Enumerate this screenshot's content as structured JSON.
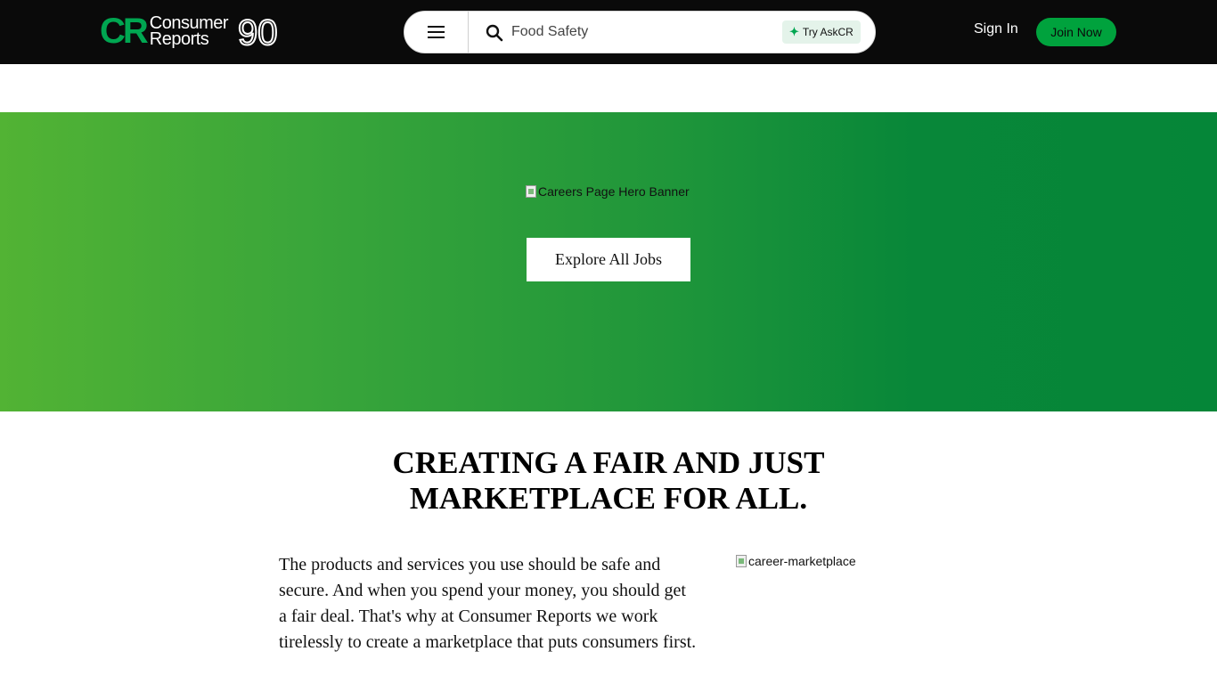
{
  "header": {
    "logo": {
      "cr": "CR",
      "line1": "Consumer",
      "line2": "Reports",
      "anniversary": "90"
    },
    "menu_icon": "hamburger-menu-icon",
    "search": {
      "icon": "search-icon",
      "value": "Food Safety",
      "placeholder": "Food Safety"
    },
    "askcr": {
      "icon": "sparkle-icon",
      "label": "Try AskCR"
    },
    "sign_in": "Sign In",
    "join_now": "Join Now"
  },
  "hero": {
    "image_alt": "Careers Page Hero Banner",
    "button_label": "Explore All Jobs"
  },
  "main": {
    "headline_line1": "CREATING A FAIR AND JUST",
    "headline_line2": "MARKETPLACE FOR ALL.",
    "body": "The products and services you use should be safe and secure. And when you spend your money, you should get a fair deal. That's why at Consumer Reports we work tirelessly to create a marketplace that puts consumers first.",
    "image_alt": "career-marketplace"
  },
  "colors": {
    "header_bg": "#0a0a0a",
    "brand_green": "#00a651",
    "hero_gradient_start": "#52b334",
    "hero_gradient_end": "#058638"
  }
}
